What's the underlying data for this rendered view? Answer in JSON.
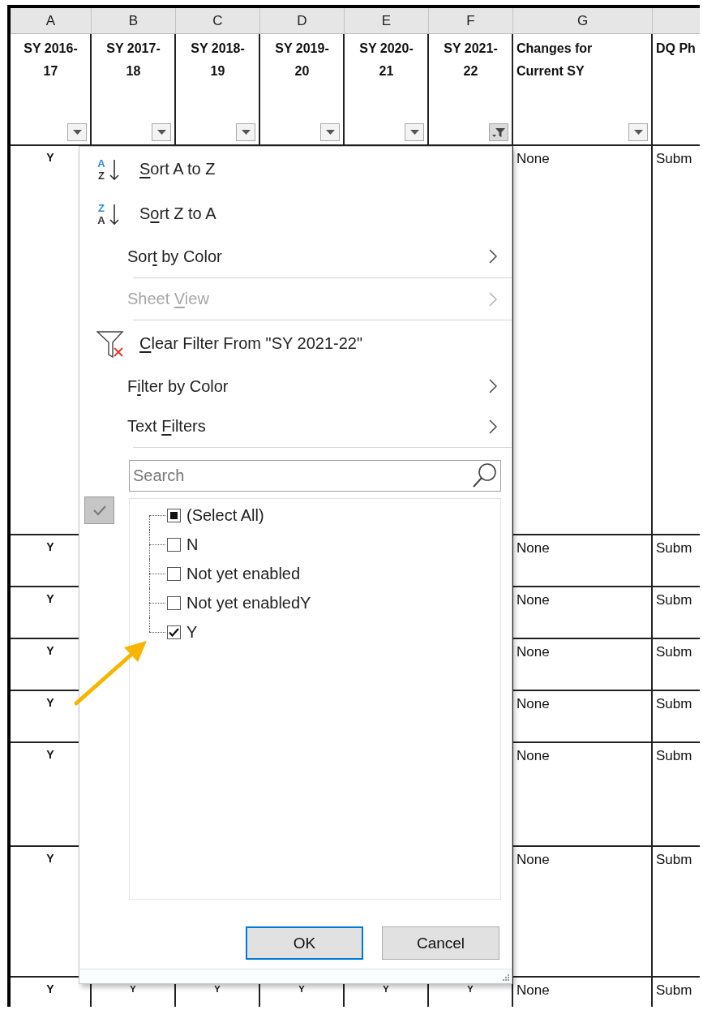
{
  "sheet": {
    "columns": [
      {
        "letter": "A",
        "header": "SY 2016-17",
        "filtered": false
      },
      {
        "letter": "B",
        "header": "SY 2017-18",
        "filtered": false
      },
      {
        "letter": "C",
        "header": "SY 2018-19",
        "filtered": false
      },
      {
        "letter": "D",
        "header": "SY 2019-20",
        "filtered": false
      },
      {
        "letter": "E",
        "header": "SY 2020-21",
        "filtered": false
      },
      {
        "letter": "F",
        "header": "SY 2021-22",
        "filtered": true
      },
      {
        "letter": "G",
        "header": "Changes for Current SY",
        "filtered": false
      },
      {
        "header": "DQ Ph"
      }
    ],
    "rows": [
      {
        "sy_2016_17": "Y",
        "changes": "None",
        "dq_ph": "Subm"
      },
      {
        "sy_2016_17": "Y",
        "changes": "None",
        "dq_ph": "Subm"
      },
      {
        "sy_2016_17": "Y",
        "changes": "None",
        "dq_ph": "Subm"
      },
      {
        "sy_2016_17": "Y",
        "changes": "None",
        "dq_ph": "Subm"
      },
      {
        "sy_2016_17": "Y",
        "changes": "None",
        "dq_ph": "Subm"
      },
      {
        "sy_2016_17": "Y",
        "changes": "None",
        "dq_ph": "Subm"
      },
      {
        "sy_2016_17": "Y",
        "changes": "None",
        "dq_ph": "Subm"
      },
      {
        "sy_2016_17": "Y",
        "sy_2017_18": "Y",
        "sy_2018_19": "Y",
        "sy_2019_20": "Y",
        "sy_2020_21": "Y",
        "sy_2021_22": "Y",
        "changes": "None",
        "dq_ph": "Subm"
      }
    ]
  },
  "filter_menu": {
    "commands": [
      {
        "kind": "sort",
        "icon_top": "A",
        "icon_bottom": "Z",
        "label": [
          {
            "text": "S",
            "access_key": true
          },
          {
            "text": "ort A to Z",
            "access_key": false
          }
        ]
      },
      {
        "kind": "sort",
        "icon_top": "Z",
        "icon_bottom": "A",
        "label": [
          {
            "text": "S",
            "access_key": false
          },
          {
            "text": "o",
            "access_key": true
          },
          {
            "text": "rt Z to A",
            "access_key": false
          }
        ]
      },
      {
        "kind": "submenu",
        "disabled": false,
        "label": [
          {
            "text": "Sor",
            "access_key": false
          },
          {
            "text": "t",
            "access_key": true
          },
          {
            "text": " by Color",
            "access_key": false
          }
        ]
      },
      {
        "kind": "separator"
      },
      {
        "kind": "submenu",
        "disabled": true,
        "label": [
          {
            "text": "Sheet ",
            "access_key": false
          },
          {
            "text": "V",
            "access_key": true
          },
          {
            "text": "iew",
            "access_key": false
          }
        ]
      },
      {
        "kind": "separator"
      },
      {
        "kind": "clear_filter",
        "label": [
          {
            "text": "C",
            "access_key": true
          },
          {
            "text": "lear Filter From \"SY 2021-22\"",
            "access_key": false
          }
        ]
      },
      {
        "kind": "submenu",
        "disabled": false,
        "label": [
          {
            "text": "F",
            "access_key": false
          },
          {
            "text": "i",
            "access_key": true
          },
          {
            "text": "lter by Color",
            "access_key": false
          }
        ]
      },
      {
        "kind": "submenu",
        "disabled": false,
        "label": [
          {
            "text": "Text ",
            "access_key": false
          },
          {
            "text": "F",
            "access_key": true
          },
          {
            "text": "ilters",
            "access_key": false
          }
        ]
      },
      {
        "kind": "separator"
      }
    ],
    "search": {
      "placeholder": "Search"
    },
    "values": [
      {
        "label": "(Select All)",
        "indeterminate": true
      },
      {
        "label": "N",
        "checked": false
      },
      {
        "label": "Not yet enabled",
        "checked": false
      },
      {
        "label": "Not yet enabledY",
        "checked": false
      },
      {
        "label": "Y",
        "checked": true
      }
    ],
    "buttons": [
      {
        "label": "OK",
        "default": true
      },
      {
        "label": "Cancel",
        "default": false
      }
    ]
  }
}
